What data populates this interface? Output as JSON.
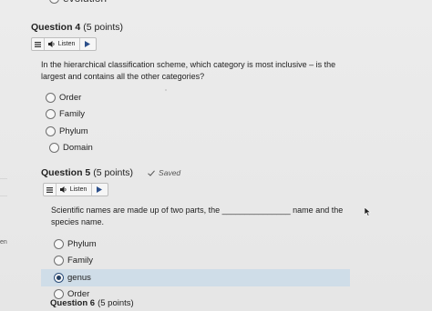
{
  "previous_question": {
    "last_option_label": "evolution"
  },
  "left_fragment": "en",
  "questions": [
    {
      "number": "Question 4",
      "points": "(5 points)",
      "listen_label": "Listen",
      "text": "In the hierarchical classification scheme, which category is most inclusive – is the largest and contains all the other categories?",
      "options": [
        "Order",
        "Family",
        "Phylum",
        "Domain"
      ]
    },
    {
      "number": "Question 5",
      "points": "(5 points)",
      "status": "Saved",
      "listen_label": "Listen",
      "text": "Scientific names are made up of two parts, the _______________ name and the species name.",
      "options": [
        "Phylum",
        "Family",
        "genus",
        "Order"
      ],
      "selected_option": "genus"
    },
    {
      "number": "Question 6",
      "points": "(5 points)"
    }
  ],
  "icons": {
    "menu": "menu-icon",
    "speaker": "speaker-icon",
    "play": "play-icon",
    "check": "check-icon",
    "cursor": "mouse-pointer-icon"
  }
}
